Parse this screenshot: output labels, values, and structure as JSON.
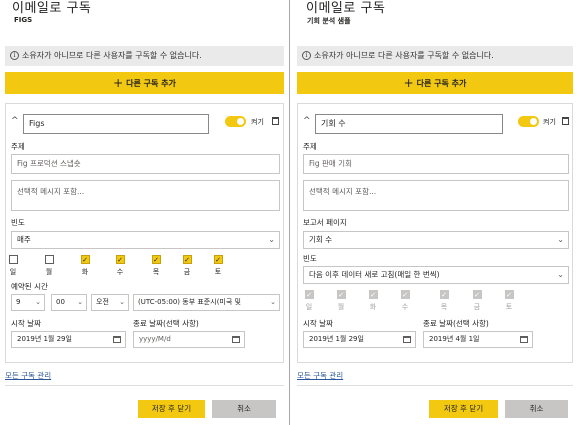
{
  "left": {
    "title": "이메일로 구독",
    "subtitle": "FIGS",
    "info_message": "소유자가 아니므로 다른 사용자를 구독할 수 없습니다.",
    "add_label": "다른 구독 추가",
    "name_value": "Figs",
    "toggle_label": "켜기",
    "subject_label": "주제",
    "subject_value": "Fig 프로덕션 스냅숏",
    "message_placeholder": "선택적 메시지 포함...",
    "frequency_label": "빈도",
    "frequency_value": "매주",
    "days": [
      {
        "label": "일",
        "checked": false
      },
      {
        "label": "월",
        "checked": false
      },
      {
        "label": "화",
        "checked": true
      },
      {
        "label": "수",
        "checked": true
      },
      {
        "label": "목",
        "checked": true
      },
      {
        "label": "금",
        "checked": true
      },
      {
        "label": "토",
        "checked": true
      }
    ],
    "time_label": "예약된 시간",
    "hour": "9",
    "minute": "00",
    "ampm": "오전",
    "timezone": "(UTC-05:00) 동부 표준시(미국 및",
    "start_label": "시작 날짜",
    "start_value": "2019년 1월 29일",
    "end_label": "종료 날짜(선택 사항)",
    "end_placeholder": "yyyy/M/d",
    "manage_link": "모든 구독 관리",
    "save_label": "저장 후 닫기",
    "cancel_label": "취소"
  },
  "right": {
    "title": "이메일로 구독",
    "subtitle": "기회 분석 샘플",
    "info_message": "소유자가 아니므로 다른 사용자를 구독할 수 없습니다.",
    "add_label": "다른 구독 추가",
    "name_value": "기회 수",
    "toggle_label": "켜기",
    "subject_label": "주제",
    "subject_value": "Fig 판매 기회",
    "message_placeholder": "선택적 메시지 포함...",
    "report_page_label": "보고서 페이지",
    "report_page_value": "기회 수",
    "frequency_label": "빈도",
    "frequency_value": "다음 이후 데이터 새로 고침(매일 한 번씩)",
    "days": [
      {
        "label": "일",
        "checked": true
      },
      {
        "label": "월",
        "checked": true
      },
      {
        "label": "화",
        "checked": true
      },
      {
        "label": "수",
        "checked": true
      },
      {
        "label": "목",
        "checked": true
      },
      {
        "label": "금",
        "checked": true
      },
      {
        "label": "토",
        "checked": true
      }
    ],
    "start_label": "시작 날짜",
    "start_value": "2019년 1월 29일",
    "end_label": "종료 날짜(선택 사항)",
    "end_value": "2019년 4월 1일",
    "manage_link": "모든 구독 관리",
    "save_label": "저장 후 닫기",
    "cancel_label": "취소"
  },
  "colors": {
    "accent": "#f2c811",
    "link": "#2b579a",
    "info_bar": "#eaeaea",
    "cancel_button": "#c8c6c4"
  },
  "icons": {
    "info": "info-icon",
    "add": "plus-icon",
    "collapse": "chevron-up-icon",
    "delete": "trash-icon",
    "dropdown": "chevron-down-icon",
    "calendar": "calendar-icon",
    "check": "checkmark-icon"
  }
}
